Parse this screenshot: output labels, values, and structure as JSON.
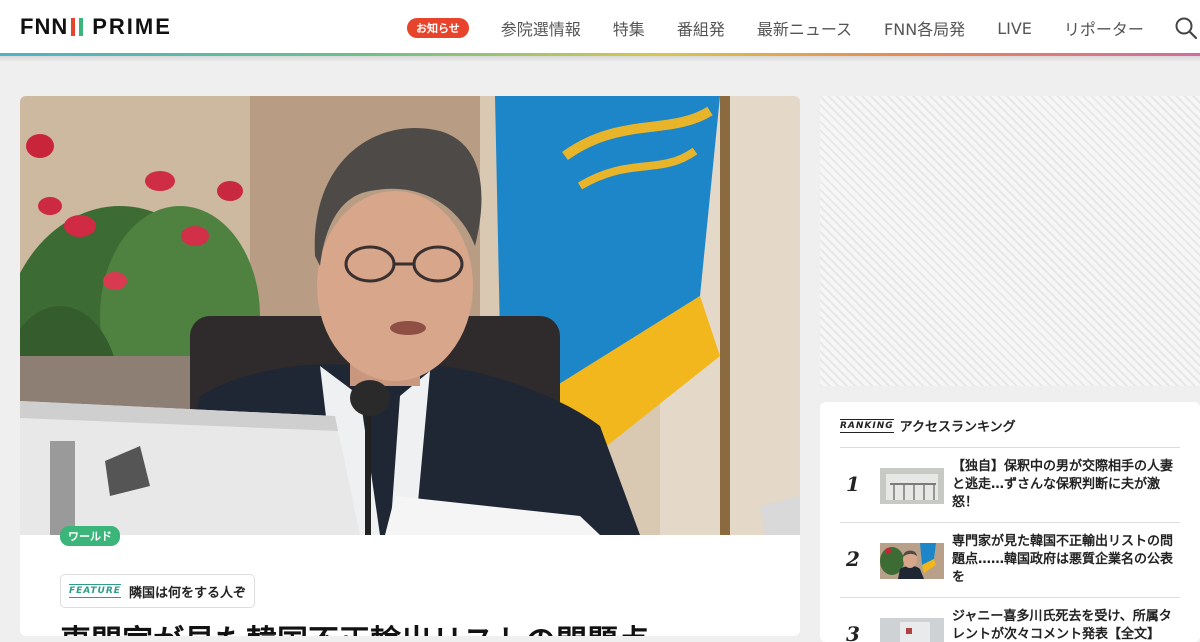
{
  "header": {
    "logo_fnn": "FNN",
    "logo_prime": "PRIME",
    "notice_label": "お知らせ",
    "nav": [
      "参院選情報",
      "特集",
      "番組発",
      "最新ニュース",
      "FNN各局発",
      "LIVE",
      "リポーター"
    ],
    "search_icon": "search-icon",
    "gradient_colors": [
      "#4bb3c9",
      "#69c08b",
      "#d8c64b",
      "#e98a4f",
      "#d46aa0"
    ]
  },
  "article": {
    "category": "ワールド",
    "category_color": "#3bb57a",
    "feature_logo": "FEATURE",
    "feature_title": "隣国は何をする人ぞ",
    "headline": "専門家が見た韓国不正輸出リストの問題点"
  },
  "ranking": {
    "logo": "RANKING",
    "title": "アクセスランキング",
    "items": [
      {
        "rank": "1",
        "title": "【独自】保釈中の男が交際相手の人妻と逃走…ずさんな保釈判断に夫が激怒！"
      },
      {
        "rank": "2",
        "title": "専門家が見た韓国不正輸出リストの問題点……韓国政府は悪質企業名の公表を"
      },
      {
        "rank": "3",
        "title": "ジャニー喜多川氏死去を受け、所属タレントが次々コメント発表【全文】"
      }
    ]
  }
}
